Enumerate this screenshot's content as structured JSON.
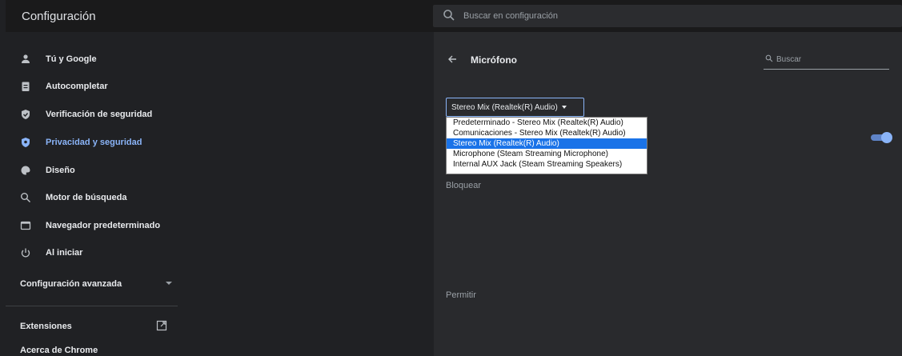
{
  "header": {
    "title": "Configuración",
    "search_placeholder": "Buscar en configuración"
  },
  "sidebar": {
    "items": [
      {
        "label": "Tú y Google",
        "icon": "person-icon"
      },
      {
        "label": "Autocompletar",
        "icon": "clipboard-icon"
      },
      {
        "label": "Verificación de seguridad",
        "icon": "shield-check-icon"
      },
      {
        "label": "Privacidad y seguridad",
        "icon": "shield-icon",
        "active": true
      },
      {
        "label": "Diseño",
        "icon": "palette-icon"
      },
      {
        "label": "Motor de búsqueda",
        "icon": "search-icon"
      },
      {
        "label": "Navegador predeterminado",
        "icon": "browser-icon"
      },
      {
        "label": "Al iniciar",
        "icon": "power-icon"
      }
    ],
    "advanced_label": "Configuración avanzada",
    "extensions_label": "Extensiones",
    "about_label": "Acerca de Chrome"
  },
  "content": {
    "title": "Micrófono",
    "search_placeholder": "Buscar",
    "selected_device": "Stereo Mix (Realtek(R) Audio)",
    "options": [
      "Predeterminado - Stereo Mix (Realtek(R) Audio)",
      "Comunicaciones - Stereo Mix (Realtek(R) Audio)",
      "Stereo Mix (Realtek(R) Audio)",
      "Microphone (Steam Streaming Microphone)",
      "Internal AUX Jack (Steam Streaming Speakers)"
    ],
    "selected_index": 2,
    "toggle_on": true,
    "block_label": "Bloquear",
    "allow_label": "Permitir"
  },
  "colors": {
    "accent": "#8ab4f8",
    "background": "#202124",
    "panel": "#292a2d",
    "selected_option": "#1a73e8"
  }
}
